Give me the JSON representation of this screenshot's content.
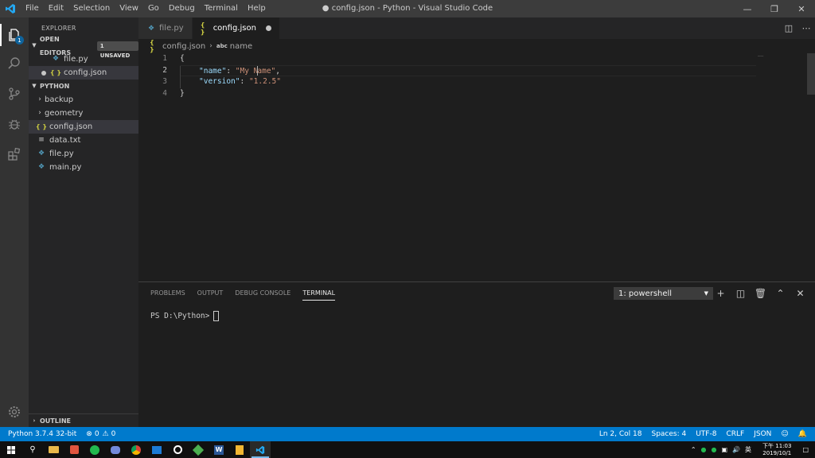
{
  "titlebar": {
    "menu": [
      "File",
      "Edit",
      "Selection",
      "View",
      "Go",
      "Debug",
      "Terminal",
      "Help"
    ],
    "title": "● config.json - Python - Visual Studio Code"
  },
  "activity": {
    "explorer_badge": "1"
  },
  "sidebar": {
    "title": "EXPLORER",
    "open_editors": {
      "label": "OPEN EDITORS",
      "badge": "1 UNSAVED",
      "items": [
        "file.py",
        "config.json"
      ]
    },
    "workspace": {
      "label": "PYTHON",
      "folders": [
        "backup",
        "geometry"
      ],
      "files": [
        "config.json",
        "data.txt",
        "file.py",
        "main.py"
      ]
    },
    "outline_label": "OUTLINE"
  },
  "tabs": [
    {
      "label": "file.py",
      "active": false
    },
    {
      "label": "config.json",
      "active": true,
      "dirty": true
    }
  ],
  "breadcrumb": {
    "file": "config.json",
    "symbol_kind": "abc",
    "symbol": "name"
  },
  "editor": {
    "line_numbers": [
      "1",
      "2",
      "3",
      "4"
    ],
    "current_line": 2,
    "lines": {
      "l1": "{",
      "l2_key": "\"name\"",
      "l2_colon": ": ",
      "l2_val_a": "\"My N",
      "l2_val_b": "ame\"",
      "l2_comma": ",",
      "l3_key": "\"version\"",
      "l3_colon": ": ",
      "l3_val": "\"1.2.5\"",
      "l4": "}"
    }
  },
  "panel": {
    "tabs": [
      "PROBLEMS",
      "OUTPUT",
      "DEBUG CONSOLE",
      "TERMINAL"
    ],
    "active_tab": "TERMINAL",
    "terminal_select": "1: powershell",
    "prompt": "PS D:\\Python>"
  },
  "statusbar": {
    "interpreter": "Python 3.7.4 32-bit",
    "errors": "0",
    "warnings": "0",
    "position": "Ln 2, Col 18",
    "spaces": "Spaces: 4",
    "encoding": "UTF-8",
    "eol": "CRLF",
    "language": "JSON"
  },
  "taskbar": {
    "ime": "英",
    "time": "下午 11:03",
    "date": "2019/10/1"
  },
  "colors": {
    "accent": "#007acc",
    "json_icon": "#cbcb41",
    "python_icon": "#519aba",
    "json_key": "#9cdcfe",
    "json_string": "#ce9178"
  }
}
